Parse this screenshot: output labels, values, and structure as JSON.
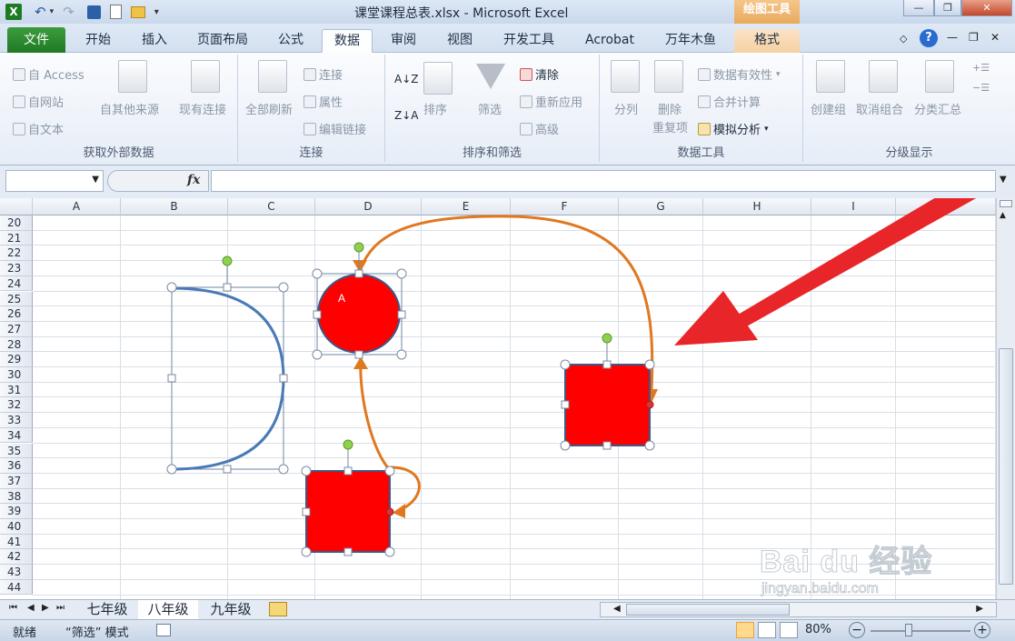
{
  "window": {
    "title": "课堂课程总表.xlsx - Microsoft Excel",
    "context_tab": "绘图工具"
  },
  "tabs": {
    "file": "文件",
    "items": [
      "开始",
      "插入",
      "页面布局",
      "公式",
      "数据",
      "审阅",
      "视图",
      "开发工具",
      "Acrobat",
      "万年木鱼",
      "格式"
    ],
    "active": "数据"
  },
  "ribbon": {
    "groups": {
      "external": {
        "label": "获取外部数据",
        "from_access": "自 Access",
        "from_web": "自网站",
        "from_text": "自文本",
        "other_sources": "自其他来源",
        "existing": "现有连接"
      },
      "connections": {
        "label": "连接",
        "refresh_all": "全部刷新",
        "connections": "连接",
        "properties": "属性",
        "edit_links": "编辑链接"
      },
      "sort": {
        "label": "排序和筛选",
        "sort": "排序",
        "filter": "筛选",
        "clear": "清除",
        "reapply": "重新应用",
        "advanced": "高级"
      },
      "tools": {
        "label": "数据工具",
        "text_to_columns": "分列",
        "remove_dups": "删除",
        "remove_dups2": "重复项",
        "validation": "数据有效性",
        "consolidate": "合并计算",
        "what_if": "模拟分析"
      },
      "outline": {
        "label": "分级显示",
        "group": "创建组",
        "ungroup": "取消组合",
        "subtotal": "分类汇总"
      }
    }
  },
  "formula_bar": {
    "fx": "fx",
    "name": "",
    "value": ""
  },
  "grid": {
    "columns": [
      "A",
      "B",
      "C",
      "D",
      "E",
      "F",
      "G",
      "H",
      "I",
      "J"
    ],
    "rows": [
      "20",
      "21",
      "22",
      "23",
      "24",
      "25",
      "26",
      "27",
      "28",
      "29",
      "30",
      "31",
      "32",
      "33",
      "34",
      "35",
      "36",
      "37",
      "38",
      "39",
      "40",
      "41",
      "42",
      "43",
      "44"
    ]
  },
  "shapes": {
    "circle_text": "A"
  },
  "sheets": {
    "items": [
      "七年级",
      "八年级",
      "九年级"
    ],
    "active": "八年级"
  },
  "status": {
    "ready": "就绪",
    "mode": "“筛选” 模式",
    "zoom": "80%"
  },
  "watermark": {
    "text": "Bai du 经验",
    "url": "jingyan.baidu.com"
  },
  "colors": {
    "shape_fill": "#ff0000",
    "connector": "#e0781f",
    "arc": "#4a7ab6",
    "annotation_arrow": "#e8262a"
  }
}
